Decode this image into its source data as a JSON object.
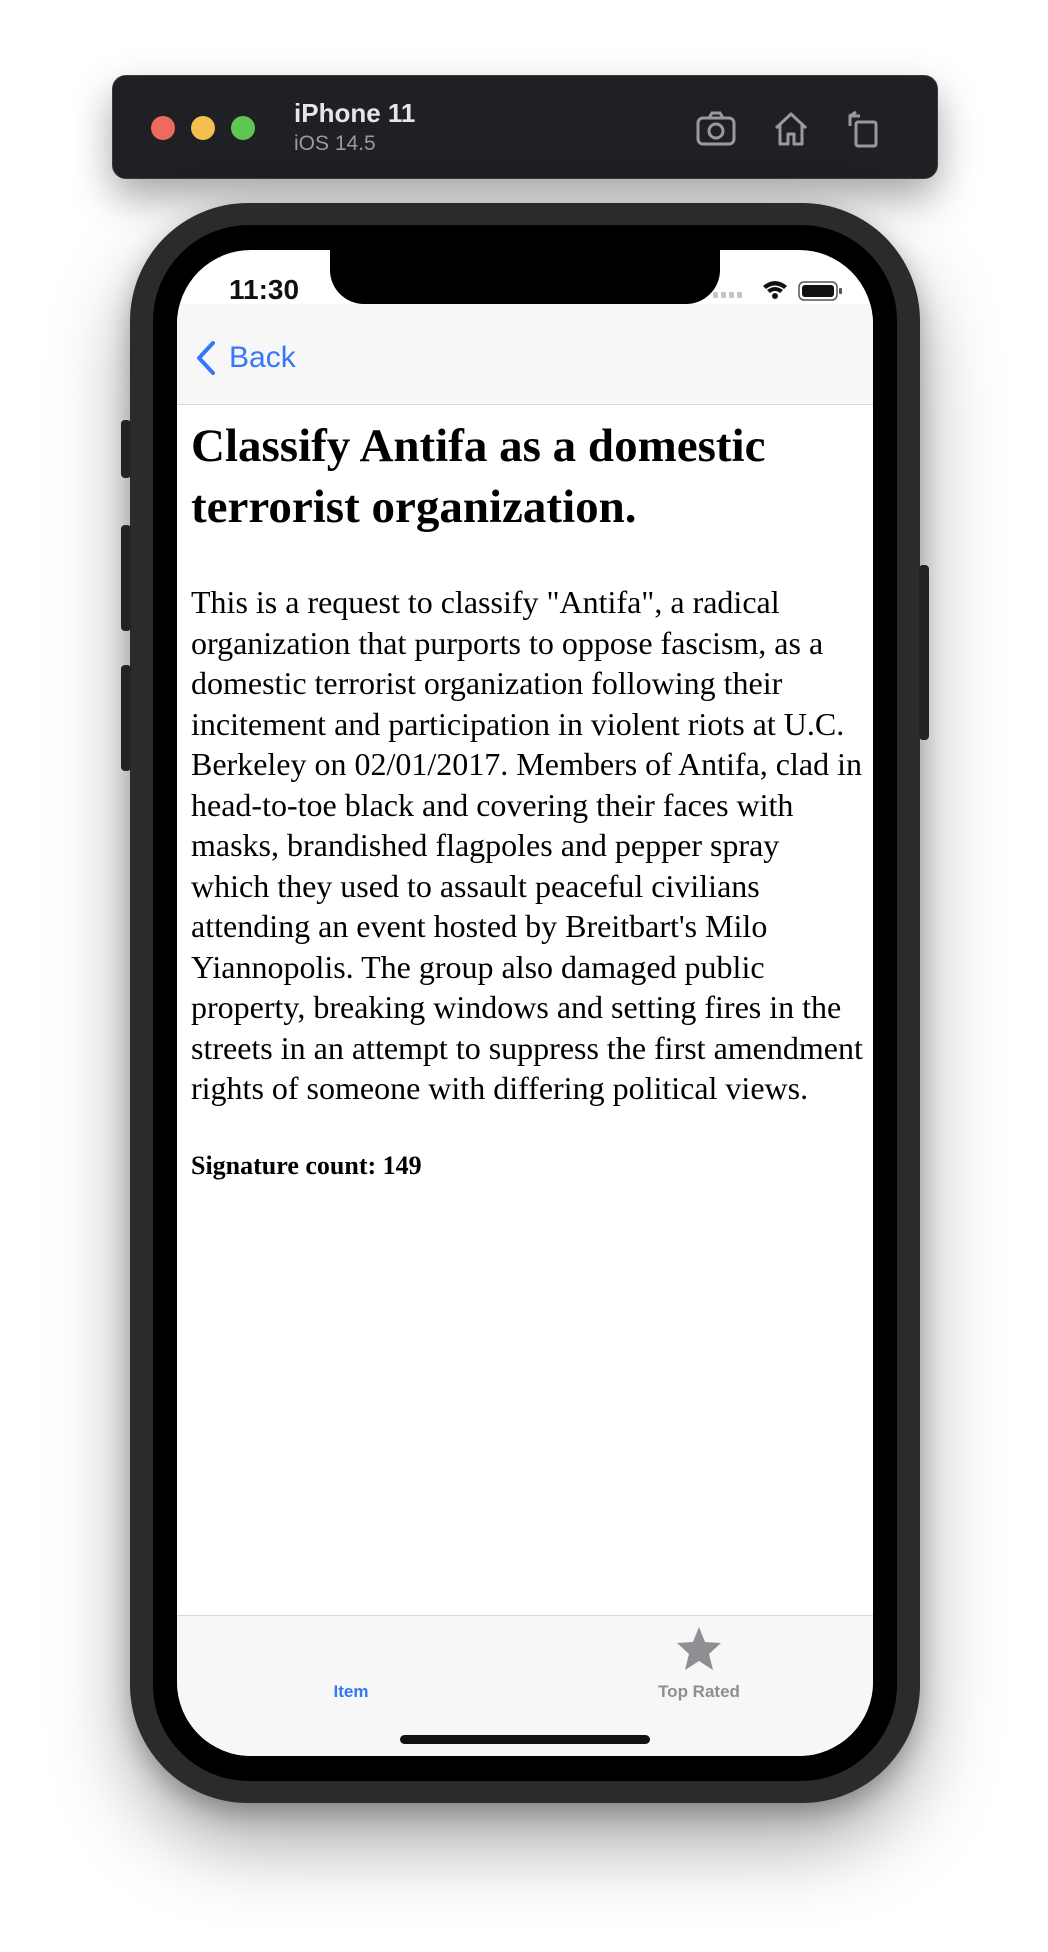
{
  "simulator": {
    "device_name": "iPhone 11",
    "os_version": "iOS 14.5",
    "icons": [
      "screenshot-icon",
      "home-icon",
      "rotate-icon"
    ]
  },
  "status_bar": {
    "time": "11:30",
    "icons": [
      "signal-icon",
      "wifi-icon",
      "battery-icon"
    ]
  },
  "nav": {
    "back_label": "Back"
  },
  "petition": {
    "title": "Classify Antifa as a domestic terrorist organization.",
    "body": "This is a request to classify \"Antifa\", a radical organization that purports to oppose fascism, as a domestic terrorist organization following their incitement and participation in violent riots at U.C. Berkeley on 02/01/2017. Members of Antifa, clad in head-to-toe black and covering their faces with masks, brandished flagpoles and pepper spray which they used to assault peaceful civilians attending an event hosted by Breitbart's Milo Yiannopolis. The group also damaged public property, breaking windows and setting fires in the streets in an attempt to suppress the first amendment rights of someone with differing political views.",
    "signature_count": "Signature count: 149"
  },
  "tabs": [
    {
      "label": "Item",
      "selected": true
    },
    {
      "label": "Top Rated",
      "selected": false,
      "icon": "star-icon"
    }
  ],
  "colors": {
    "accent": "#3478f6",
    "inactive_tab": "#8e8e93"
  }
}
